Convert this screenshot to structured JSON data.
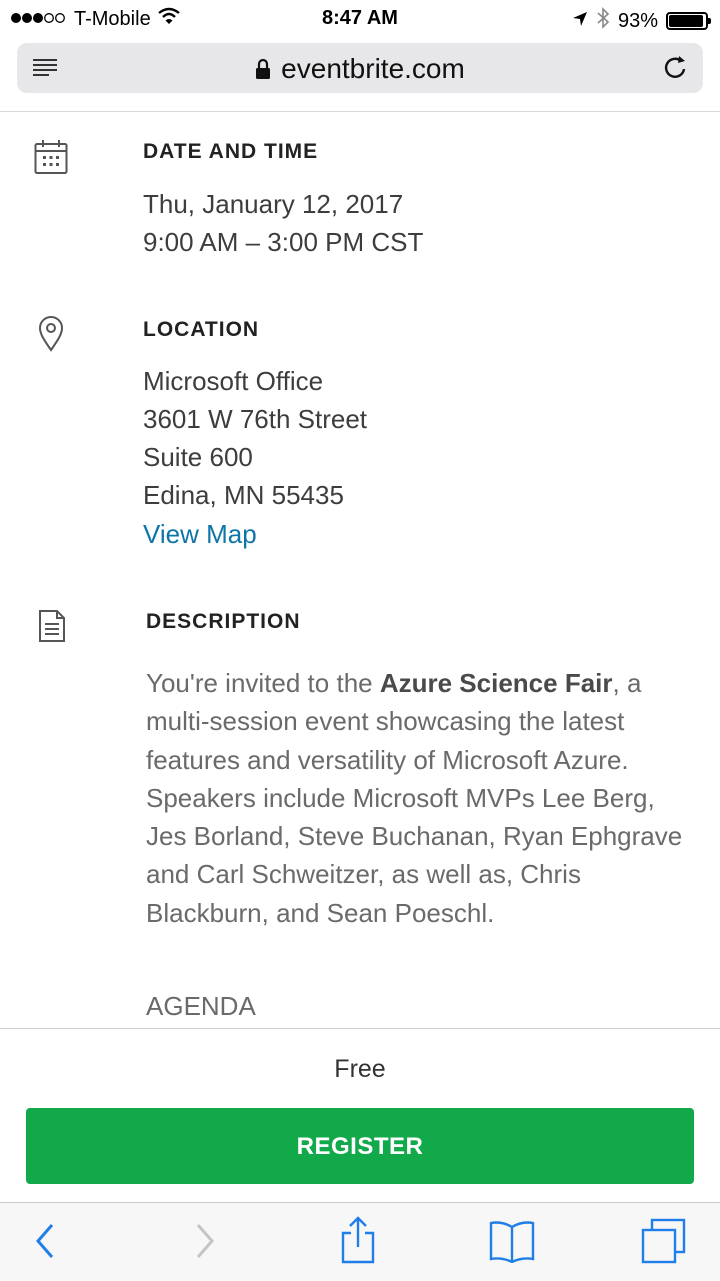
{
  "status_bar": {
    "carrier": "T-Mobile",
    "time": "8:47 AM",
    "battery": "93%",
    "battery_level": 0.93,
    "icons": [
      "signal-dots-icon",
      "wifi-icon",
      "location-arrow-icon",
      "bluetooth-icon",
      "battery-icon"
    ]
  },
  "browser": {
    "url": "eventbrite.com",
    "icons": [
      "reader-menu-icon",
      "lock-icon",
      "reload-icon"
    ]
  },
  "sections": {
    "date": {
      "heading": "DATE AND TIME",
      "line1": "Thu, January 12, 2017",
      "line2": "9:00 AM – 3:00 PM CST",
      "icon": "calendar-icon"
    },
    "location": {
      "heading": "LOCATION",
      "line1": "Microsoft Office",
      "line2": "3601 W 76th Street",
      "line3": "Suite 600",
      "line4": "Edina, MN 55435",
      "map_link": "View Map",
      "icon": "map-pin-icon"
    },
    "description": {
      "heading": "DESCRIPTION",
      "intro": "You're invited to the ",
      "event_name": "Azure Science Fair",
      "body": ", a multi-session event showcasing the latest features and versatility of Microsoft Azure. Speakers include Microsoft MVPs Lee Berg, Jes Borland, Steve Buchanan, Ryan Ephgrave and Carl Schweitzer, as well as, Chris Blackburn, and Sean Poeschl.",
      "agenda": "AGENDA",
      "icon": "document-icon"
    }
  },
  "registration": {
    "price": "Free",
    "button_label": "REGISTER",
    "button_color": "#12a94b"
  },
  "toolbar": {
    "icons": [
      "back-icon",
      "forward-icon",
      "share-icon",
      "bookmarks-icon",
      "tabs-icon"
    ],
    "accent": "#1f7ee8"
  }
}
